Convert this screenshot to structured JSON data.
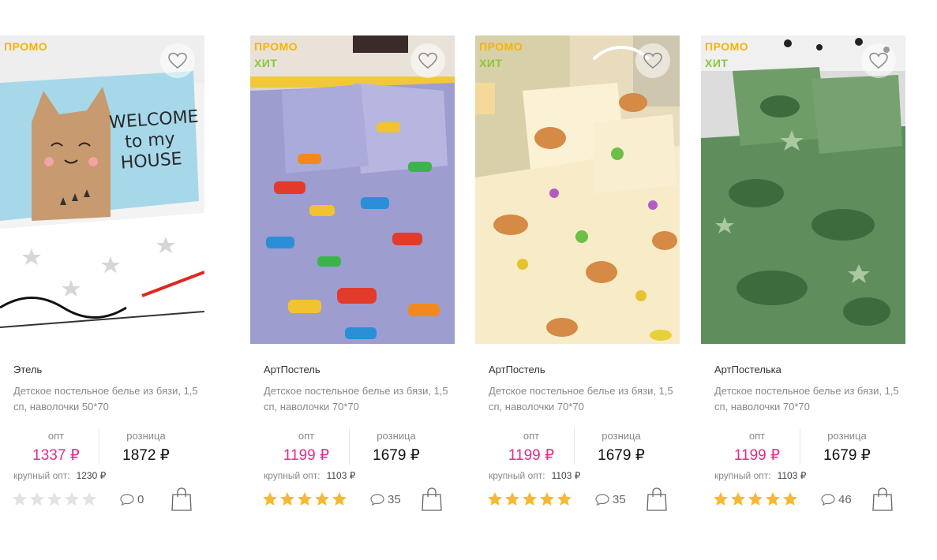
{
  "colors": {
    "promo": "#f7b500",
    "hit": "#8cc63f",
    "opt_price": "#e72a8a",
    "star_on": "#f6b934",
    "star_off": "#e3e3e3"
  },
  "products": [
    {
      "badges": [
        "ПРОМО",
        "ХИТ"
      ],
      "image": "bedding-cars-print",
      "brand": "АртПостель",
      "description": "Детское постельное белье из бязи, 1,5 сп, наволочки 70*70",
      "opt_label": "опт",
      "opt_price": "1199 ₽",
      "retail_label": "розница",
      "retail_price": "1679 ₽",
      "bulk_label": "крупный опт:",
      "bulk_price": "1103 ₽",
      "rating": 5,
      "comments": "35"
    },
    {
      "badges": [
        "ПРОМО",
        "ХИТ"
      ],
      "image": "bedding-kittens-print",
      "brand": "АртПостель",
      "description": "Детское постельное белье из бязи, 1,5 сп, наволочки 70*70",
      "opt_label": "опт",
      "opt_price": "1199 ₽",
      "retail_label": "розница",
      "retail_price": "1679 ₽",
      "bulk_label": "крупный опт:",
      "bulk_price": "1103 ₽",
      "rating": 5,
      "comments": "35"
    },
    {
      "badges": [
        "ПРОМО",
        "ХИТ"
      ],
      "image": "bedding-green-camo-stars",
      "brand": "АртПостелька",
      "description": "Детское постельное белье из бязи, 1,5 сп, наволочки 70*70",
      "opt_label": "опт",
      "opt_price": "1199 ₽",
      "retail_label": "розница",
      "retail_price": "1679 ₽",
      "bulk_label": "крупный опт:",
      "bulk_price": "1103 ₽",
      "rating": 5,
      "comments": "46"
    },
    {
      "badges": [
        "ПРОМО"
      ],
      "image": "bedding-welcome-cat",
      "brand": "Этель",
      "description": "Детское постельное белье из бязи, 1,5 сп, наволочки 50*70",
      "opt_label": "опт",
      "opt_price": "1337 ₽",
      "retail_label": "розница",
      "retail_price": "1872 ₽",
      "bulk_label": "крупный опт:",
      "bulk_price": "1230 ₽",
      "rating": 0,
      "comments": "0",
      "image_text": "WELCOME to my HOUSE"
    }
  ]
}
